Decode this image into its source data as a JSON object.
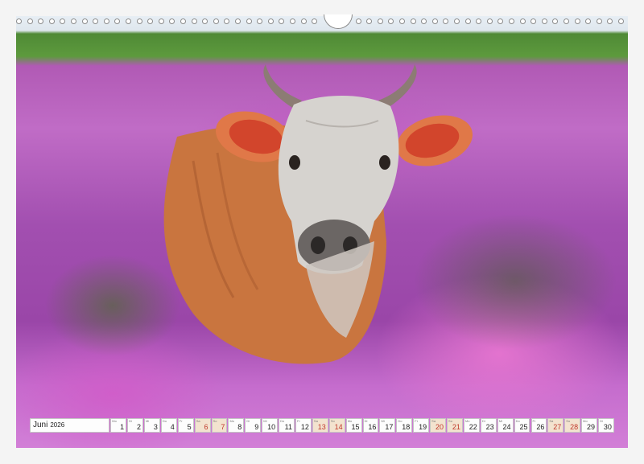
{
  "calendar": {
    "month": "Juni",
    "year": "2026",
    "days": [
      {
        "n": "1",
        "dn": "Mo"
      },
      {
        "n": "2",
        "dn": "Di"
      },
      {
        "n": "3",
        "dn": "Mi"
      },
      {
        "n": "4",
        "dn": "Do"
      },
      {
        "n": "5",
        "dn": "Fr"
      },
      {
        "n": "6",
        "dn": "Sa",
        "we": true
      },
      {
        "n": "7",
        "dn": "So",
        "we": true
      },
      {
        "n": "8",
        "dn": "Mo"
      },
      {
        "n": "9",
        "dn": "Di"
      },
      {
        "n": "10",
        "dn": "Mi"
      },
      {
        "n": "11",
        "dn": "Do"
      },
      {
        "n": "12",
        "dn": "Fr"
      },
      {
        "n": "13",
        "dn": "Sa",
        "we": true
      },
      {
        "n": "14",
        "dn": "So",
        "we": true
      },
      {
        "n": "15",
        "dn": "Mo"
      },
      {
        "n": "16",
        "dn": "Di"
      },
      {
        "n": "17",
        "dn": "Mi"
      },
      {
        "n": "18",
        "dn": "Do"
      },
      {
        "n": "19",
        "dn": "Fr"
      },
      {
        "n": "20",
        "dn": "Sa",
        "we": true
      },
      {
        "n": "21",
        "dn": "So",
        "we": true
      },
      {
        "n": "22",
        "dn": "Mo"
      },
      {
        "n": "23",
        "dn": "Di"
      },
      {
        "n": "24",
        "dn": "Mi"
      },
      {
        "n": "25",
        "dn": "Do"
      },
      {
        "n": "26",
        "dn": "Fr"
      },
      {
        "n": "27",
        "dn": "Sa",
        "we": true
      },
      {
        "n": "28",
        "dn": "So",
        "we": true
      },
      {
        "n": "29",
        "dn": "Mo"
      },
      {
        "n": "30",
        "dn": "Di"
      }
    ]
  },
  "colors": {
    "weekend_fill": "#f3e3cf",
    "weekend_text": "#c0392b"
  }
}
